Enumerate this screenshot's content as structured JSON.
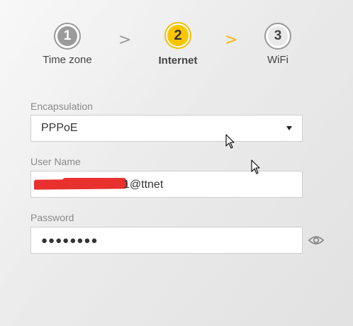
{
  "stepper": {
    "steps": [
      {
        "number": "1",
        "label": "Time zone",
        "state": "inactive"
      },
      {
        "number": "2",
        "label": "Internet",
        "state": "active"
      },
      {
        "number": "3",
        "label": "WiFi",
        "state": "inactive"
      }
    ],
    "separator": ">",
    "active_color": "#fbc400"
  },
  "form": {
    "encapsulation": {
      "label": "Encapsulation",
      "value": "PPPoE"
    },
    "username": {
      "label": "User Name",
      "value": "1@ttnet"
    },
    "password": {
      "label": "Password",
      "value": "●●●●●●●●"
    }
  },
  "icons": {
    "password_toggle": "eye-icon",
    "select_arrow": "caret-down-icon",
    "cursor": "mouse-pointer-icon"
  }
}
